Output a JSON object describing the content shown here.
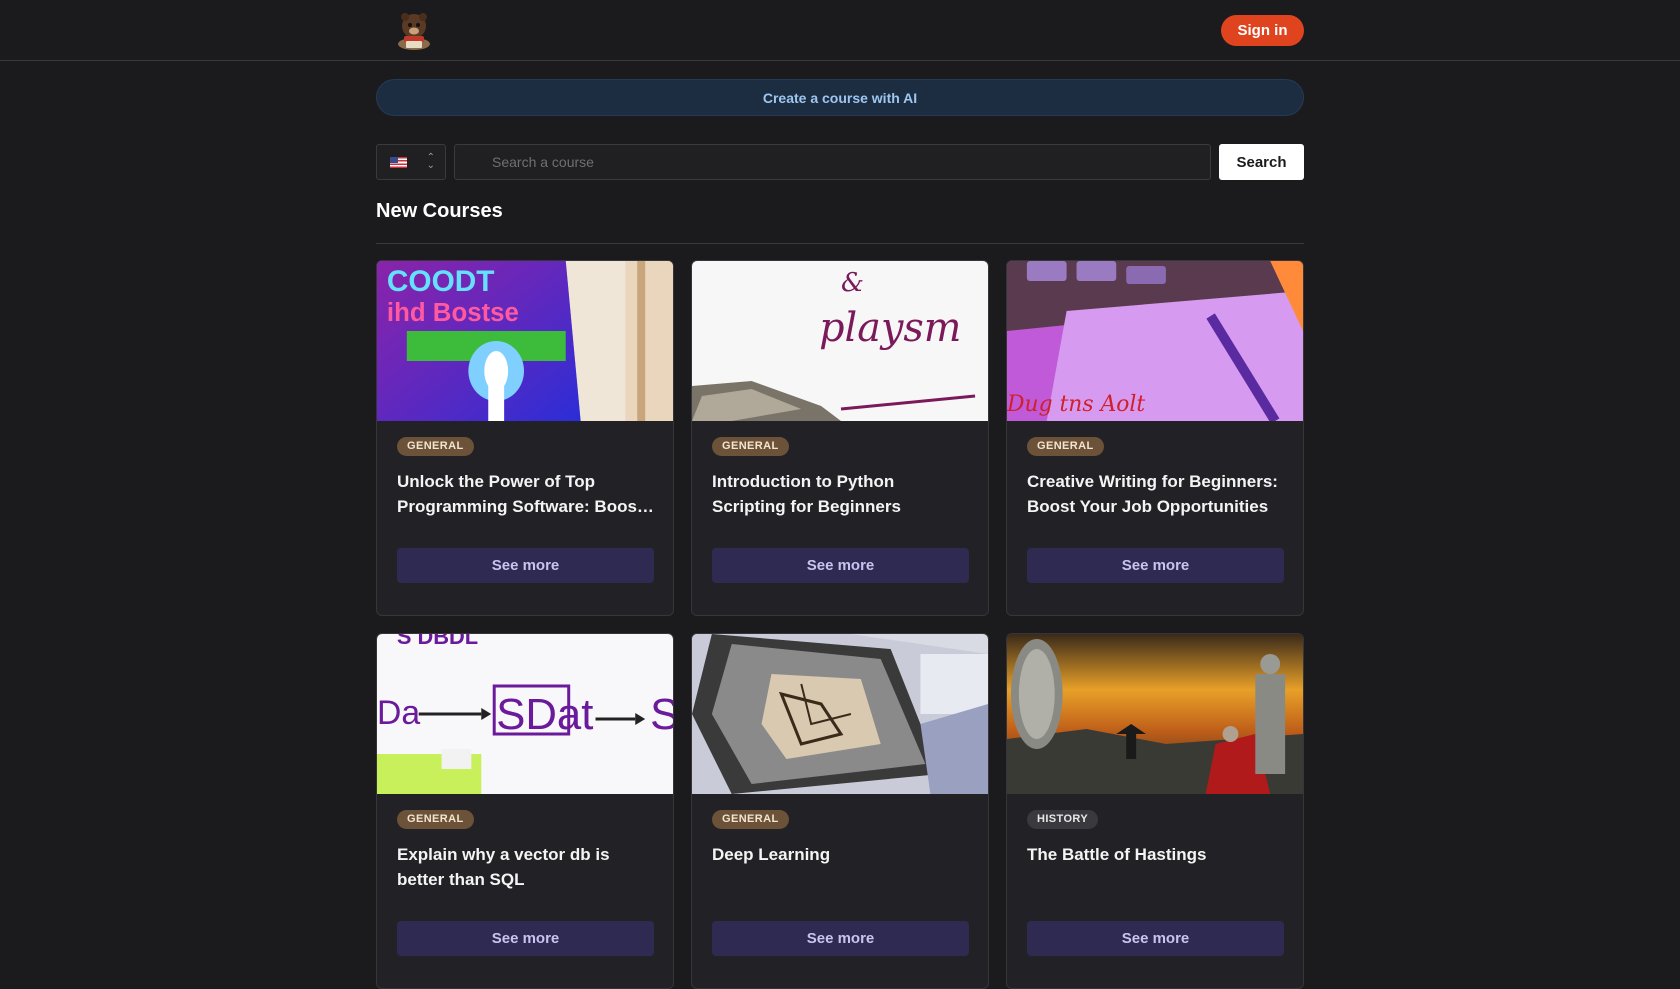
{
  "header": {
    "sign_in_label": "Sign in"
  },
  "banner": {
    "label": "Create a course with AI"
  },
  "search": {
    "language_flag": "🇺🇸",
    "placeholder": "Search a course",
    "button_label": "Search"
  },
  "section": {
    "title": "New Courses"
  },
  "courses": [
    {
      "category": "GENERAL",
      "title": "Unlock the Power of Top Programming Software: Boost Your Productivity",
      "cta": "See more"
    },
    {
      "category": "GENERAL",
      "title": "Introduction to Python Scripting for Beginners",
      "cta": "See more"
    },
    {
      "category": "GENERAL",
      "title": "Creative Writing for Beginners: Boost Your Job Opportunities",
      "cta": "See more"
    },
    {
      "category": "GENERAL",
      "title": "Explain why a vector db is better than SQL",
      "cta": "See more"
    },
    {
      "category": "GENERAL",
      "title": "Deep Learning",
      "cta": "See more"
    },
    {
      "category": "HISTORY",
      "title": "The Battle of Hastings",
      "cta": "See more"
    }
  ],
  "colors": {
    "background": "#1b1b1d",
    "accent_signin": "#e0441f",
    "banner_bg": "#1c2d42",
    "badge_general": "#6b5238",
    "badge_history": "#3a3a3e",
    "see_more_bg": "#2e2a52"
  }
}
